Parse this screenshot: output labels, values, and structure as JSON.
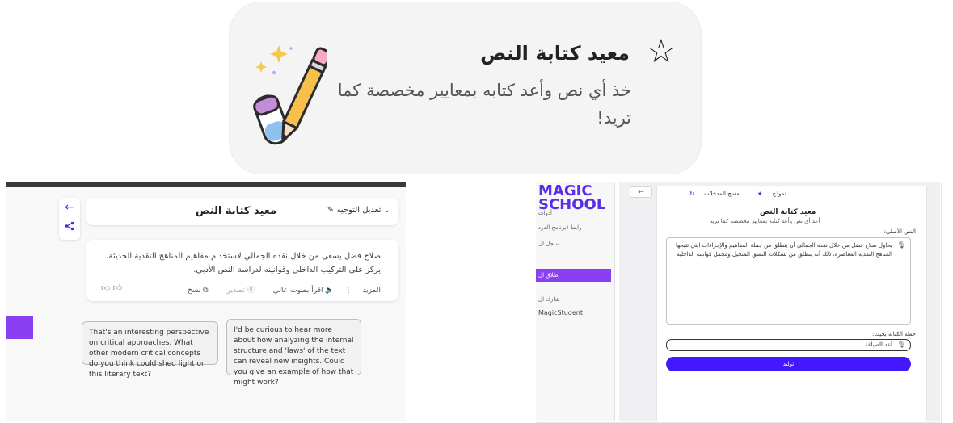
{
  "top_card": {
    "title": "معيد كتابة النص",
    "description": "خذ أي نص وأعد كتابه بمعايير مخصصة كما تريد!",
    "star_icon": "star-outline-icon",
    "illustration_icon": "pencil-eraser-sparkles-icon"
  },
  "chat_view": {
    "back_icon": "back-arrow-icon",
    "share_icon": "share-icon",
    "header": {
      "title": "معيد كتابة النص",
      "edit_label": "تعديل التوجيه"
    },
    "message": {
      "text": "صلاح فضل يسعى من خلال نقده الجمالي لاستخدام مفاهيم المناهج النقدية الحديثة، يركز على التركيب الداخلي وقوانينه لدراسة النص الأدبي.",
      "actions": {
        "more": "المزيد",
        "read_aloud": "اقرأ بصوت عالي",
        "export": "تصدير",
        "copy": "نسخ"
      }
    },
    "suggestions": [
      "That's an interesting perspective on critical approaches. What other modern critical concepts do you think could shed light on this literary text?",
      "I'd be curious to hear more about how analyzing the internal structure and 'laws' of the text can reveal new insights. Could you give an example of how that might work?"
    ],
    "colors": {
      "accent": "#3b2fe8",
      "purple": "#8a3ff2"
    }
  },
  "tool_view": {
    "logo": "MAGIC SCHOOL",
    "sidebar": {
      "items": [
        "أدوات",
        "رابط (برنامج الدرد",
        "سجل ال",
        "إطلاق ال",
        "شارك ال",
        "MagicStudent"
      ],
      "active_index": 3
    },
    "back_label": "←",
    "topbar": {
      "example": "نموذج",
      "clear": "مسح المدخلات"
    },
    "title": "معيد كتابة النص",
    "subtitle": "أعد أي نص وأعد كتابه بمعايير مخصصة كما تريد",
    "original_text_label": "النص الأصلي:",
    "original_text": "يحاول صلاح فضل من خلال نقده الجمالي أن ينطلق من جملة المفاهيم والإجراءات التي تتيحها المناهج النقدية المعاصرة، ذلك أنه ينطلق من تشكلات النسق المتخيل ومجمل قوانينه الداخلية",
    "rewrite_label": "خطة الكتابة بحيث:",
    "rewrite_value": "أعد الصياغة",
    "generate_label": "توليد",
    "colors": {
      "generate": "#4318ff",
      "sidebar_active": "#8a3ff2"
    }
  }
}
